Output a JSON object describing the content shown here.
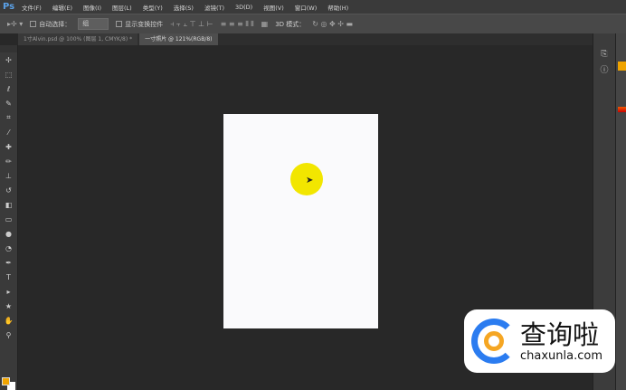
{
  "app": {
    "logo": "Ps"
  },
  "menu": [
    "文件(F)",
    "编辑(E)",
    "图像(I)",
    "图层(L)",
    "类型(Y)",
    "选择(S)",
    "滤镜(T)",
    "3D(D)",
    "视图(V)",
    "窗口(W)",
    "帮助(H)"
  ],
  "options": {
    "auto_select_label": "自动选择：",
    "auto_select_value": "组",
    "show_transform_label": "显示变换控件",
    "mode_3d_label": "3D 模式："
  },
  "tabs": [
    {
      "label": "1寸Alvin.psd @ 100% (图层 1, CMYK/8) *"
    },
    {
      "label": "一寸照片 @ 121%(RGB/8)"
    }
  ],
  "colors": {
    "foreground": "#f0a400",
    "background": "#ffffff",
    "highlight": "#f2e600"
  },
  "watermark": {
    "name": "查询啦",
    "domain": "chaxunla.com"
  }
}
